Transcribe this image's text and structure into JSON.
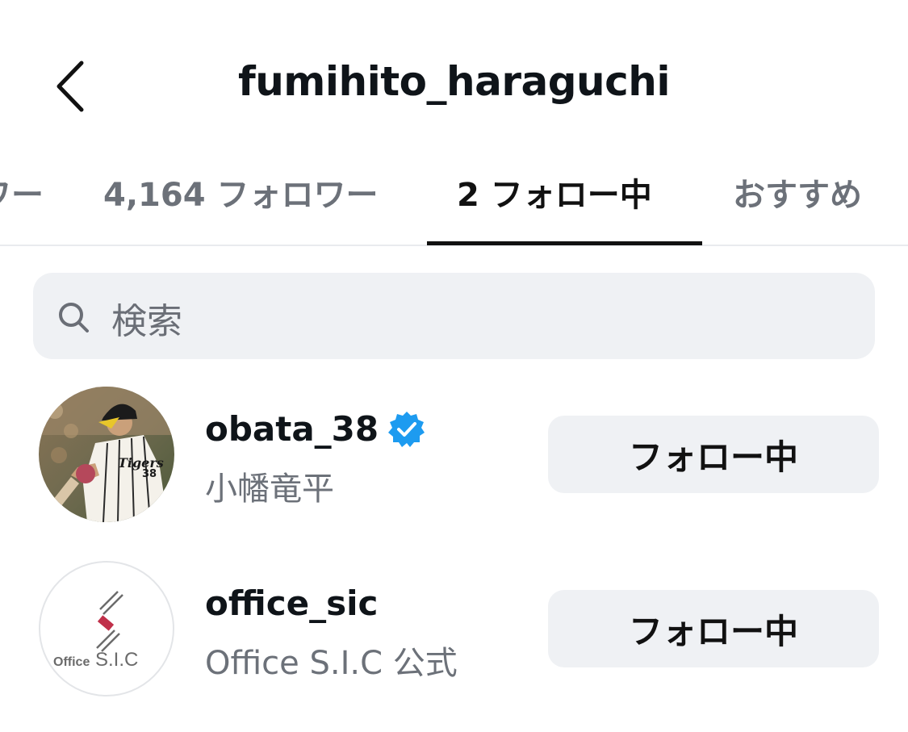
{
  "header": {
    "title": "fumihito_haraguchi"
  },
  "tabs": [
    {
      "label": "ワー"
    },
    {
      "label": "4,164 フォロワー"
    },
    {
      "label": "2 フォロー中"
    },
    {
      "label": "おすすめ"
    }
  ],
  "search": {
    "placeholder": "検索"
  },
  "following": [
    {
      "username": "obata_38",
      "full_name": "小幡竜平",
      "verified": true,
      "button_label": "フォロー中"
    },
    {
      "username": "office_sic",
      "full_name": "Office S.I.C 公式",
      "verified": false,
      "button_label": "フォロー中"
    }
  ],
  "avatar_logo": {
    "word": "Office",
    "initials": "S.I.C"
  },
  "colors": {
    "verified_badge": "#1d9bf0",
    "button_bg": "#eff1f4",
    "muted_text": "#6c7179",
    "accent_text": "#111111"
  }
}
